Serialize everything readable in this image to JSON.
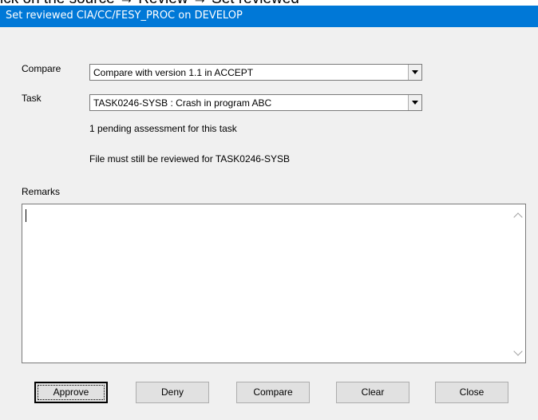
{
  "background_caption": "ick on the source → Review → Set reviewed",
  "window": {
    "title": "Set reviewed CIA/CC/FESY_PROC on DEVELOP"
  },
  "form": {
    "compare_label": "Compare",
    "compare_value": "Compare with version 1.1 in ACCEPT",
    "task_label": "Task",
    "task_value": "TASK0246-SYSB : Crash in program ABC",
    "pending_text": "1 pending assessment for this task",
    "review_status_text": "File must still be reviewed for TASK0246-SYSB",
    "remarks_label": "Remarks",
    "remarks_value": ""
  },
  "buttons": {
    "approve": "Approve",
    "deny": "Deny",
    "compare": "Compare",
    "clear": "Clear",
    "close": "Close"
  },
  "colors": {
    "titlebar": "#0078d7",
    "dialog_bg": "#f0f0f0"
  }
}
